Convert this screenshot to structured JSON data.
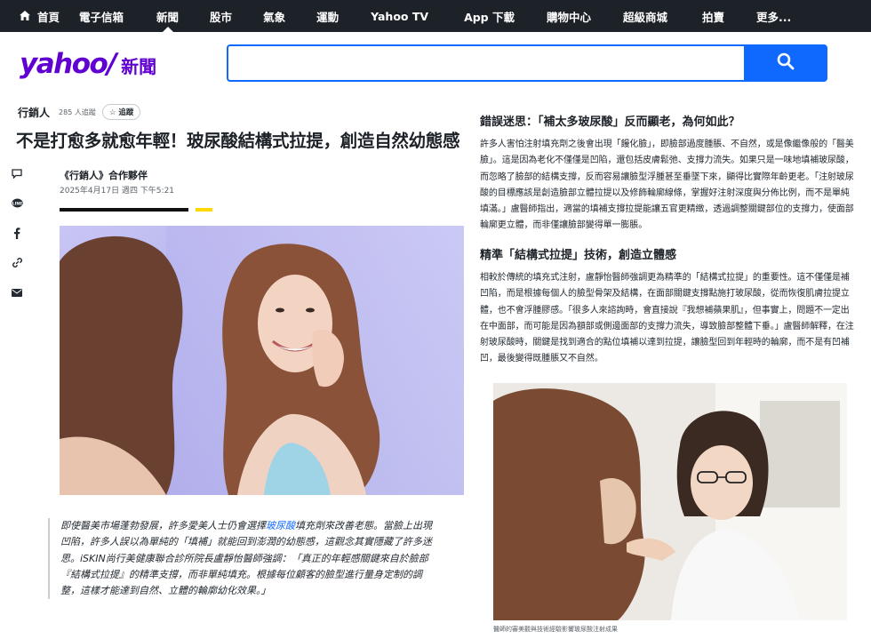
{
  "nav": {
    "items": [
      "首頁",
      "電子信箱",
      "新聞",
      "股市",
      "氣象",
      "運動",
      "Yahoo TV",
      "App 下載",
      "購物中心",
      "超級商城",
      "拍賣",
      "更多..."
    ],
    "active_index": 2
  },
  "header": {
    "logo_text": "yahoo/",
    "section": "新聞",
    "search_placeholder": "",
    "brand_color": "#6001d2",
    "accent_color": "#0f69ff"
  },
  "article": {
    "publisher": "行銷人",
    "followers": "285 人追蹤",
    "follow_label": "追蹤",
    "title": "不是打愈多就愈年輕！玻尿酸結構式拉提，創造自然幼態感",
    "author": "《行銷人》合作夥伴",
    "date": "2025年4月17日 週四 下午5:21",
    "caption_before_link": "即使醫美市場蓬勃發展，許多愛美人士仍會選擇",
    "caption_link": "玻尿酸",
    "caption_after_link": "填充劑來改善老態。當臉上出現凹陷，許多人誤以為單純的「填補」就能回到澎潤的幼態感，這觀念其實隱藏了許多迷思。iSKIN尚行美健康聯合診所院長盧靜怡醫師強調：「真正的年輕感關鍵來自於臉部『結構式拉提』的精準支撐，而非單純填充。根據每位顧客的臉型進行量身定制的調整，這樣才能達到自然、立體的輪廓幼化效果。」"
  },
  "share": [
    "comment-icon",
    "line-icon",
    "facebook-icon",
    "link-icon",
    "mail-icon"
  ],
  "right": {
    "h1": "錯誤迷思：「補太多玻尿酸」反而顯老，為何如此？",
    "p1": "許多人害怕注射填充劑之後會出現「饅化臉」，即臉部過度腫脹、不自然，或是像繼像般的「醫美臉」。這是因為老化不僅僅是凹陷，還包括皮膚鬆弛、支撐力流失。如果只是一味地填補玻尿酸，而忽略了臉部的結構支撐，反而容易讓臉型浮腫甚至垂墜下來，顯得比實際年齡更老。「注射玻尿酸的目標應該是創造臉部立體拉提以及修飾輪廓線條，掌握好注射深度與分佈比例，而不是單純填滿。」盧醫師指出，適當的填補支撐拉提能讓五官更精緻，透過調整關鍵部位的支撐力，使面部輪廓更立體，而非僅讓臉部變得單一膨脹。",
    "h2": "精準「結構式拉提」技術，創造立體感",
    "p2": "相較於傳統的填充式注射，盧靜怡醫師強調更為精準的「結構式拉提」的重要性。這不僅僅是補凹陷，而是根據每個人的臉型骨架及結構，在面部關鍵支撐點施打玻尿酸，從而恢復肌膚拉提立體，也不會浮腫膠感。「很多人來諮詢時，會直接說『我想補蘋果肌』，但事實上，問題不一定出在中面部，而可能是因為額部或側邊面部的支撐力流失，導致臉部整體下垂。」盧醫師解釋，在注射玻尿酸時，關鍵是找到適合的點位填補以達到拉提，讓臉型回到年輕時的輪廓，而不是有凹補凹，最後變得既腫脹又不自然。",
    "photo_caption": "醫師的審美觀與技術經驗影響玻尿酸注射成果"
  }
}
